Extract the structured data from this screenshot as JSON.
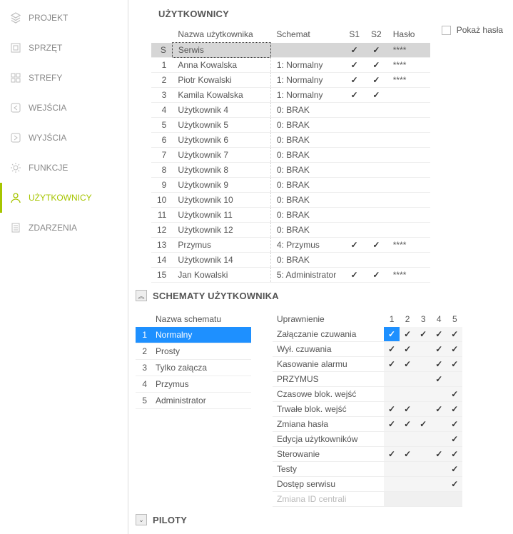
{
  "sidebar": {
    "items": [
      {
        "label": "PROJEKT"
      },
      {
        "label": "SPRZĘT"
      },
      {
        "label": "STREFY"
      },
      {
        "label": "WEJŚCIA"
      },
      {
        "label": "WYJŚCIA"
      },
      {
        "label": "FUNKCJE"
      },
      {
        "label": "UŻYTKOWNICY"
      },
      {
        "label": "ZDARZENIA"
      }
    ],
    "active_index": 6
  },
  "users_section": {
    "title": "UŻYTKOWNICY",
    "columns": {
      "id": "",
      "name": "Nazwa użytkownika",
      "scheme": "Schemat",
      "s1": "S1",
      "s2": "S2",
      "pwd": "Hasło"
    },
    "show_passwords_label": "Pokaż hasła",
    "rows": [
      {
        "id": "S",
        "name": "Serwis",
        "scheme": "",
        "s1": true,
        "s2": true,
        "pwd": "****",
        "svc": true
      },
      {
        "id": "1",
        "name": "Anna Kowalska",
        "scheme": "1: Normalny",
        "s1": true,
        "s2": true,
        "pwd": "****"
      },
      {
        "id": "2",
        "name": "Piotr Kowalski",
        "scheme": "1: Normalny",
        "s1": true,
        "s2": true,
        "pwd": "****"
      },
      {
        "id": "3",
        "name": "Kamila Kowalska",
        "scheme": "1: Normalny",
        "s1": true,
        "s2": true,
        "pwd": ""
      },
      {
        "id": "4",
        "name": "Użytkownik  4",
        "scheme": "0: BRAK",
        "s1": false,
        "s2": false,
        "pwd": ""
      },
      {
        "id": "5",
        "name": "Użytkownik  5",
        "scheme": "0: BRAK",
        "s1": false,
        "s2": false,
        "pwd": ""
      },
      {
        "id": "6",
        "name": "Użytkownik  6",
        "scheme": "0: BRAK",
        "s1": false,
        "s2": false,
        "pwd": ""
      },
      {
        "id": "7",
        "name": "Użytkownik  7",
        "scheme": "0: BRAK",
        "s1": false,
        "s2": false,
        "pwd": ""
      },
      {
        "id": "8",
        "name": "Użytkownik  8",
        "scheme": "0: BRAK",
        "s1": false,
        "s2": false,
        "pwd": ""
      },
      {
        "id": "9",
        "name": "Użytkownik  9",
        "scheme": "0: BRAK",
        "s1": false,
        "s2": false,
        "pwd": ""
      },
      {
        "id": "10",
        "name": "Użytkownik 10",
        "scheme": "0: BRAK",
        "s1": false,
        "s2": false,
        "pwd": ""
      },
      {
        "id": "11",
        "name": "Użytkownik 11",
        "scheme": "0: BRAK",
        "s1": false,
        "s2": false,
        "pwd": ""
      },
      {
        "id": "12",
        "name": "Użytkownik 12",
        "scheme": "0: BRAK",
        "s1": false,
        "s2": false,
        "pwd": ""
      },
      {
        "id": "13",
        "name": "Przymus",
        "scheme": "4: Przymus",
        "s1": true,
        "s2": true,
        "pwd": "****"
      },
      {
        "id": "14",
        "name": "Użytkownik 14",
        "scheme": "0: BRAK",
        "s1": false,
        "s2": false,
        "pwd": ""
      },
      {
        "id": "15",
        "name": "Jan Kowalski",
        "scheme": "5: Administrator",
        "s1": true,
        "s2": true,
        "pwd": "****"
      }
    ]
  },
  "schemes_section": {
    "title": "SCHEMATY UŻYTKOWNIKA",
    "list_header": "Nazwa schematu",
    "schemes": [
      {
        "id": "1",
        "name": "Normalny",
        "selected": true
      },
      {
        "id": "2",
        "name": "Prosty",
        "selected": false
      },
      {
        "id": "3",
        "name": "Tylko załącza",
        "selected": false
      },
      {
        "id": "4",
        "name": "Przymus",
        "selected": false
      },
      {
        "id": "5",
        "name": "Administrator",
        "selected": false
      }
    ],
    "perm_header": "Uprawnienie",
    "perm_cols": [
      "1",
      "2",
      "3",
      "4",
      "5"
    ],
    "permissions": [
      {
        "name": "Załączanie czuwania",
        "v": [
          true,
          true,
          true,
          true,
          true
        ],
        "selcol": 0
      },
      {
        "name": "Wył. czuwania",
        "v": [
          true,
          true,
          false,
          true,
          true
        ]
      },
      {
        "name": "Kasowanie alarmu",
        "v": [
          true,
          true,
          false,
          true,
          true
        ]
      },
      {
        "name": "PRZYMUS",
        "v": [
          false,
          false,
          false,
          true,
          false
        ]
      },
      {
        "name": "Czasowe blok. wejść",
        "v": [
          false,
          false,
          false,
          false,
          true
        ]
      },
      {
        "name": "Trwałe blok. wejść",
        "v": [
          true,
          true,
          false,
          true,
          true
        ]
      },
      {
        "name": "Zmiana hasła",
        "v": [
          true,
          true,
          true,
          false,
          true
        ]
      },
      {
        "name": "Edycja użytkowników",
        "v": [
          false,
          false,
          false,
          false,
          true
        ]
      },
      {
        "name": "Sterowanie",
        "v": [
          true,
          true,
          false,
          true,
          true
        ]
      },
      {
        "name": "Testy",
        "v": [
          false,
          false,
          false,
          false,
          true
        ]
      },
      {
        "name": "Dostęp serwisu",
        "v": [
          false,
          false,
          false,
          false,
          true
        ]
      },
      {
        "name": "Zmiana ID centrali",
        "v": [
          false,
          false,
          false,
          false,
          false
        ],
        "disabled": true
      }
    ]
  },
  "remotes_section": {
    "title": "PILOTY"
  }
}
